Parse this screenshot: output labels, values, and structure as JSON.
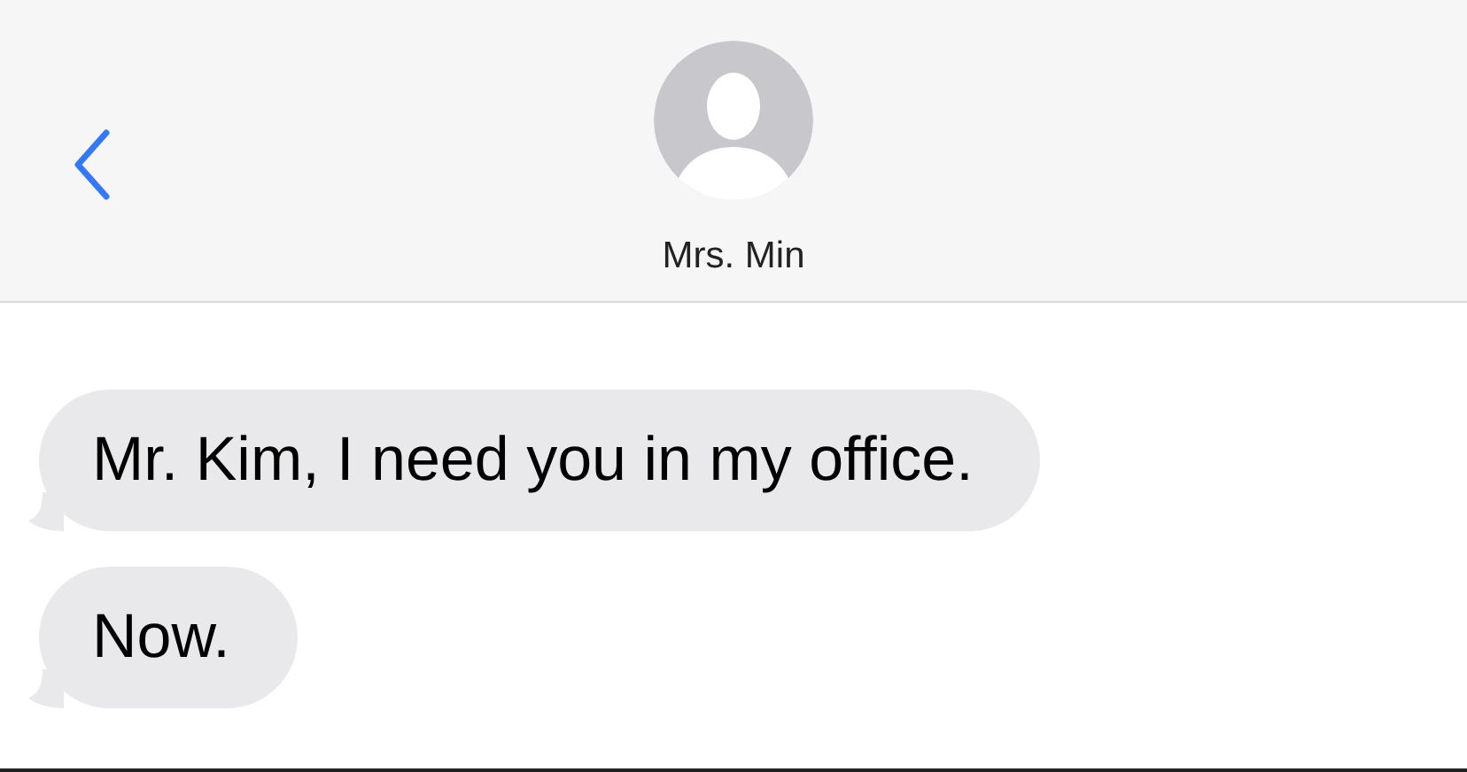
{
  "header": {
    "contact_name": "Mrs. Min"
  },
  "messages": [
    {
      "kind": "received",
      "text": "Mr. Kim, I need you in my office."
    },
    {
      "kind": "received",
      "text": "Now."
    }
  ]
}
